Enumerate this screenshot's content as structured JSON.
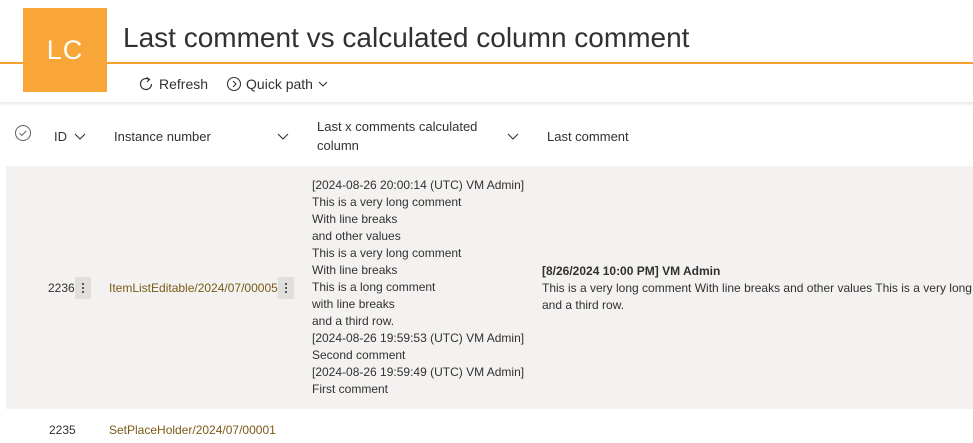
{
  "header": {
    "logo_text": "LC",
    "title": "Last comment vs calculated column comment"
  },
  "toolbar": {
    "refresh_label": "Refresh",
    "quick_path_label": "Quick path"
  },
  "columns": {
    "id": "ID",
    "instance_number": "Instance number",
    "last_x_comments_line1": "Last x comments calculated",
    "last_x_comments_line2": "column",
    "last_comment": "Last comment"
  },
  "rows": [
    {
      "id": "2236",
      "instance_number": "ItemListEditable/2024/07/00005",
      "calculated_lines": [
        "[2024-08-26 20:00:14 (UTC) VM Admin]",
        "This is a very long comment",
        "With line breaks",
        "and other values",
        "This is a very long comment",
        "With line breaks",
        "This is a long comment",
        "with line breaks",
        "and a third row.",
        "[2024-08-26 19:59:53 (UTC) VM Admin]",
        "Second comment",
        "[2024-08-26 19:59:49 (UTC) VM Admin]",
        "First comment"
      ],
      "last_comment_header": "[8/26/2024 10:00 PM] VM Admin",
      "last_comment_line1": "This is a very long comment With line breaks and other values This is a very long c",
      "last_comment_line2": "and a third row."
    },
    {
      "id": "2235",
      "instance_number": "SetPlaceHolder/2024/07/00001"
    }
  ],
  "colors": {
    "accent": "#f7a637",
    "header_border": "#f4a12e",
    "link": "#7a5a15",
    "row_selected_bg": "#f3f2f1"
  }
}
